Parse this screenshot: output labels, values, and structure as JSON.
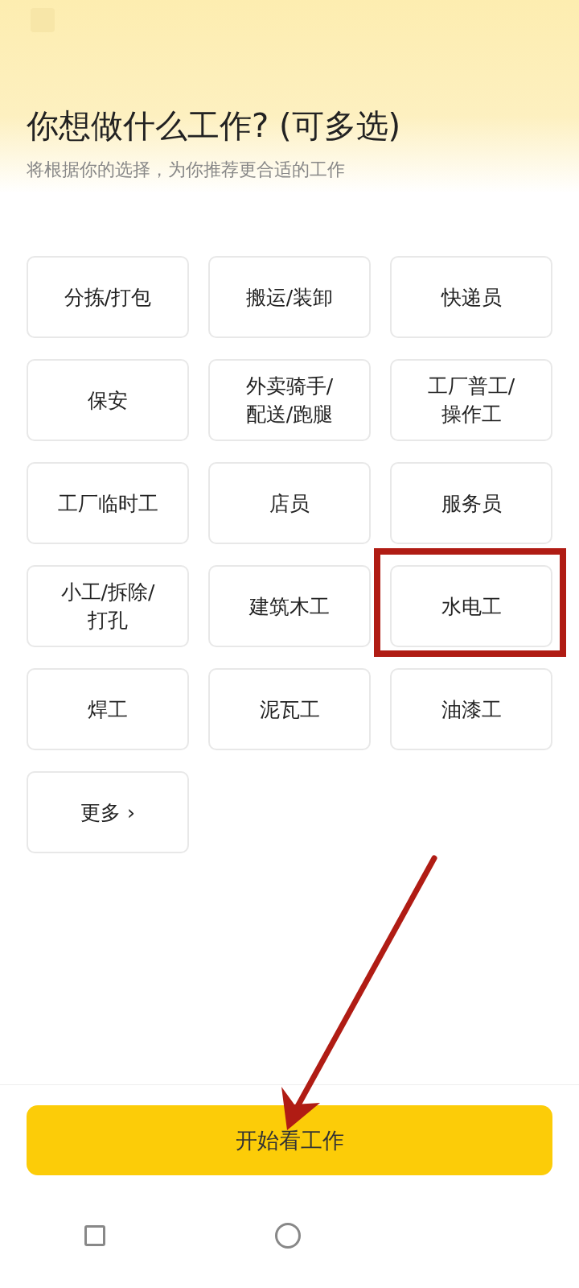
{
  "header": {
    "title": "你想做什么工作? (可多选)",
    "subtitle": "将根据你的选择，为你推荐更合适的工作"
  },
  "options": [
    {
      "label": "分拣/打包",
      "selected": false
    },
    {
      "label": "搬运/装卸",
      "selected": false
    },
    {
      "label": "快递员",
      "selected": false
    },
    {
      "label": "保安",
      "selected": false
    },
    {
      "label": "外卖骑手/\n配送/跑腿",
      "selected": false
    },
    {
      "label": "工厂普工/\n操作工",
      "selected": false
    },
    {
      "label": "工厂临时工",
      "selected": false
    },
    {
      "label": "店员",
      "selected": false
    },
    {
      "label": "服务员",
      "selected": false
    },
    {
      "label": "小工/拆除/\n打孔",
      "selected": false
    },
    {
      "label": "建筑木工",
      "selected": false
    },
    {
      "label": "水电工",
      "selected": false
    },
    {
      "label": "焊工",
      "selected": false
    },
    {
      "label": "泥瓦工",
      "selected": false
    },
    {
      "label": "油漆工",
      "selected": false
    },
    {
      "label": "更多 ›",
      "selected": false
    }
  ],
  "primary_button": {
    "label": "开始看工作"
  }
}
